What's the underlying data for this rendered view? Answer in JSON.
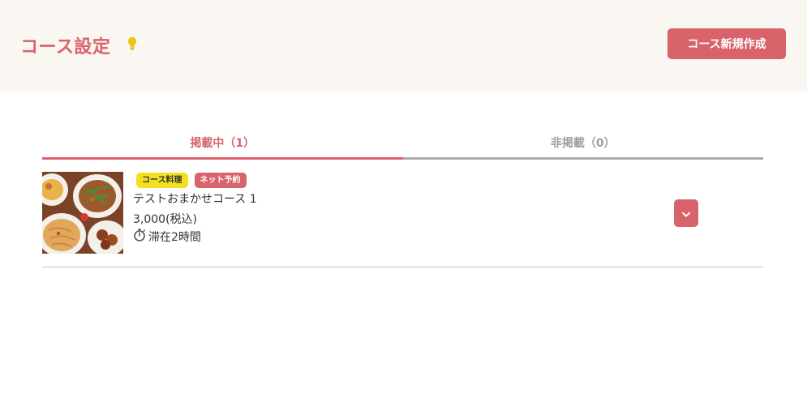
{
  "header": {
    "title": "コース設定",
    "hint_icon": "lightbulb-icon",
    "new_button_label": "コース新規作成"
  },
  "tabs": [
    {
      "label": "掲載中（1）",
      "active": true
    },
    {
      "label": "非掲載（0）",
      "active": false
    }
  ],
  "courses": [
    {
      "tags": [
        "コース料理",
        "ネット予約"
      ],
      "name": "テストおまかせコース 1",
      "price": "3,000(税込)",
      "stay_icon": "stopwatch-icon",
      "stay": "滞在2時間",
      "expand_icon": "chevron-down-icon"
    }
  ],
  "colors": {
    "accent": "#d9636b",
    "header_bg": "#faf6f1",
    "tag_yellow": "#f2e020",
    "inactive_tab": "#9d9d9d"
  }
}
